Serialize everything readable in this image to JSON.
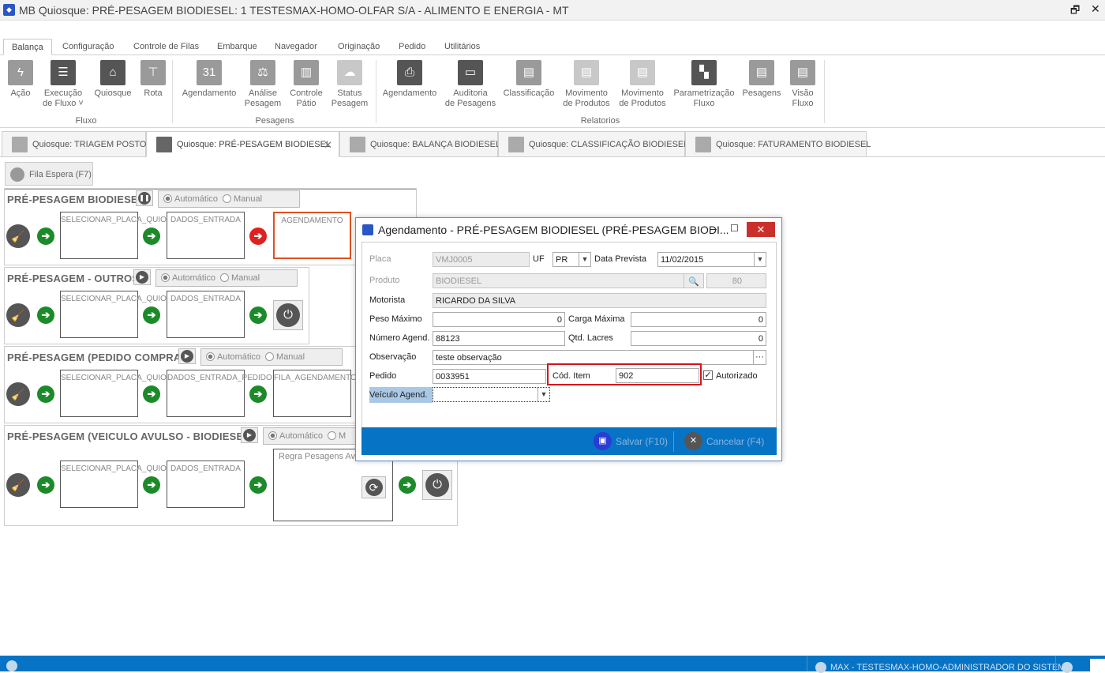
{
  "window": {
    "title": "MB Quiosque: PRÉ-PESAGEM BIODIESEL: 1 TESTESMAX-HOMO-OLFAR S/A - ALIMENTO E ENERGIA - MT",
    "maximize": "🗗",
    "close": "✕"
  },
  "ribbon_tabs": [
    "Balança",
    "Configuração",
    "Controle de Filas",
    "Embarque",
    "Navegador",
    "Originação",
    "Pedido",
    "Utilitários"
  ],
  "ribbon": {
    "fluxo": {
      "label": "Fluxo",
      "buttons": [
        {
          "l1": "Ação",
          "l2": "",
          "icon": "lightning-icon",
          "glyph": "ϟ"
        },
        {
          "l1": "Execução",
          "l2": "de Fluxo ˅",
          "icon": "list-icon",
          "glyph": "☰"
        },
        {
          "l1": "Quiosque",
          "l2": "",
          "icon": "kiosk-house-icon",
          "glyph": "⌂"
        },
        {
          "l1": "Rota",
          "l2": "",
          "icon": "signpost-icon",
          "glyph": "⊤"
        }
      ]
    },
    "pesagens": {
      "label": "Pesagens",
      "buttons": [
        {
          "l1": "Agendamento",
          "l2": "",
          "icon": "calendar-icon",
          "glyph": "31"
        },
        {
          "l1": "Análise",
          "l2": "Pesagem",
          "icon": "scale-gear-icon",
          "glyph": "⚖"
        },
        {
          "l1": "Controle",
          "l2": "Pátio",
          "icon": "bar-chart-icon",
          "glyph": "▥"
        },
        {
          "l1": "Status",
          "l2": "Pesagem",
          "icon": "cloud-icon",
          "glyph": "☁"
        }
      ]
    },
    "relatorios": {
      "label": "Relatorios",
      "buttons": [
        {
          "l1": "Agendamento",
          "l2": "",
          "icon": "report-clock-icon",
          "glyph": "⎙"
        },
        {
          "l1": "Auditoria",
          "l2": "de Pesagens",
          "icon": "window-icon",
          "glyph": "▭"
        },
        {
          "l1": "Classificação",
          "l2": "",
          "icon": "document-icon",
          "glyph": "▤"
        },
        {
          "l1": "Movimento",
          "l2": "de Produtos",
          "icon": "document-icon",
          "glyph": "▤"
        },
        {
          "l1": "Movimento",
          "l2": "de Produtos",
          "icon": "document-icon",
          "glyph": "▤"
        },
        {
          "l1": "Parametrização",
          "l2": "Fluxo",
          "icon": "checker-icon",
          "glyph": "▚"
        },
        {
          "l1": "Pesagens",
          "l2": "",
          "icon": "document-gear-icon",
          "glyph": "▤"
        },
        {
          "l1": "Visão",
          "l2": "Fluxo",
          "icon": "document-power-icon",
          "glyph": "▤"
        }
      ]
    }
  },
  "doc_tabs": [
    "Quiosque: TRIAGEM POSTO",
    "Quiosque: PRÉ-PESAGEM BIODIESEL",
    "Quiosque: BALANÇA BIODIESEL",
    "Quiosque: CLASSIFICAÇÃO BIODIESEL",
    "Quiosque: FATURAMENTO BIODIESEL"
  ],
  "doc_tab_close": "✕",
  "fila_espera": "Fila Espera (F7)",
  "panels": [
    {
      "title": "PRÉ-PESAGEM BIODIESEL",
      "auto": "Automático",
      "manual": "Manual",
      "steps": [
        "SELECIONAR_PLACA_QUIOSQUE",
        "DADOS_ENTRADA",
        "AGENDAMENTO"
      ]
    },
    {
      "title": "PRÉ-PESAGEM - OUTROS",
      "auto": "Automático",
      "manual": "Manual",
      "steps": [
        "SELECIONAR_PLACA_QUIOSQUE",
        "DADOS_ENTRADA"
      ]
    },
    {
      "title": "PRÉ-PESAGEM (PEDIDO COMPRA)",
      "auto": "Automático",
      "manual": "Manual",
      "steps": [
        "SELECIONAR_PLACA_QUIOSQUE",
        "DADOS_ENTRADA_PEDIDO",
        "FILA_AGENDAMENTO"
      ]
    },
    {
      "title": "PRÉ-PESAGEM (VEICULO AVULSO - BIODIESEL)",
      "auto": "Automático",
      "manual": "M",
      "steps": [
        "SELECIONAR_PLACA_QUIOSQUE",
        "DADOS_ENTRADA",
        "Regra Pesagens Avu"
      ]
    }
  ],
  "glyphs": {
    "arrow": "➔",
    "broom": "🧹",
    "power": "⏻",
    "pause": "❚❚",
    "play": "▶",
    "refresh": "⟳"
  },
  "dialog": {
    "title": "Agendamento - PRÉ-PESAGEM BIODIESEL (PRÉ-PESAGEM BIODI...",
    "min": "–",
    "max": "☐",
    "close": "✕",
    "labels": {
      "placa": "Placa",
      "uf": "UF",
      "data_prevista": "Data Prevista",
      "produto": "Produto",
      "motorista": "Motorista",
      "peso_maximo": "Peso Máximo",
      "carga_maxima": "Carga Máxima",
      "numero_agend": "Número Agend.",
      "qtd_lacres": "Qtd. Lacres",
      "observacao": "Observação",
      "pedido": "Pedido",
      "cod_item": "Cód. Item",
      "autorizado": "Autorizado",
      "veiculo_agend": "Veículo Agend."
    },
    "values": {
      "placa": "VMJ0005",
      "uf": "PR",
      "data_prevista": "11/02/2015",
      "produto": "BIODIESEL",
      "produto_code": "80",
      "motorista": "RICARDO DA SILVA",
      "peso_maximo": "0",
      "carga_maxima": "0",
      "numero_agend": "88123",
      "qtd_lacres": "0",
      "observacao": "teste observação",
      "pedido": "0033951",
      "cod_item": "902",
      "autorizado": true,
      "veiculo_agend": ""
    },
    "ellipsis": "···",
    "search_glyph": "🔍",
    "save": "Salvar (F10)",
    "cancel": "Cancelar (F4)"
  },
  "status": {
    "user": "MAX - TESTESMAX-HOMO-ADMINISTRADOR DO SISTEMA"
  },
  "colors": {
    "accent": "#0773c4",
    "highlight_red": "#d6131b",
    "highlight_orange": "#e0501e",
    "go_green": "#1d8a2a",
    "stop_red": "#e02020"
  }
}
